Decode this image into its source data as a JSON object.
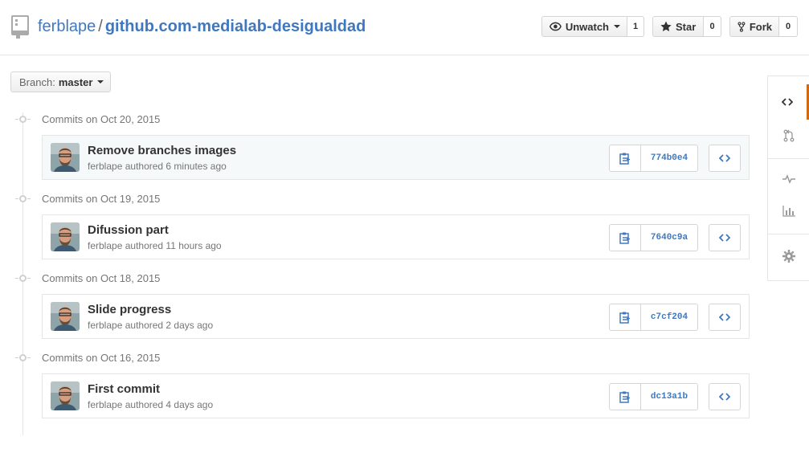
{
  "repo": {
    "owner": "ferblape",
    "separator": "/",
    "name": "github.com-medialab-desigualdad"
  },
  "actions": {
    "watch": {
      "label": "Unwatch",
      "count": "1"
    },
    "star": {
      "label": "Star",
      "count": "0"
    },
    "fork": {
      "label": "Fork",
      "count": "0"
    }
  },
  "branch": {
    "prefix": "Branch:",
    "name": "master"
  },
  "commit_groups": [
    {
      "date": "Commits on Oct 20, 2015",
      "commit": {
        "title": "Remove branches images",
        "author": "ferblape",
        "meta": "authored 6 minutes ago",
        "sha": "774b0e4"
      }
    },
    {
      "date": "Commits on Oct 19, 2015",
      "commit": {
        "title": "Difussion part",
        "author": "ferblape",
        "meta": "authored 11 hours ago",
        "sha": "7640c9a"
      }
    },
    {
      "date": "Commits on Oct 18, 2015",
      "commit": {
        "title": "Slide progress",
        "author": "ferblape",
        "meta": "authored 2 days ago",
        "sha": "c7cf204"
      }
    },
    {
      "date": "Commits on Oct 16, 2015",
      "commit": {
        "title": "First commit",
        "author": "ferblape",
        "meta": "authored 4 days ago",
        "sha": "dc13a1b"
      }
    }
  ],
  "sidebar_nav": [
    "code-icon",
    "pull-request-icon",
    "pulse-icon",
    "graph-icon",
    "settings-icon"
  ],
  "colors": {
    "link": "#4078c0",
    "selected_nav": "#d26911",
    "sha": "#4078c0"
  }
}
